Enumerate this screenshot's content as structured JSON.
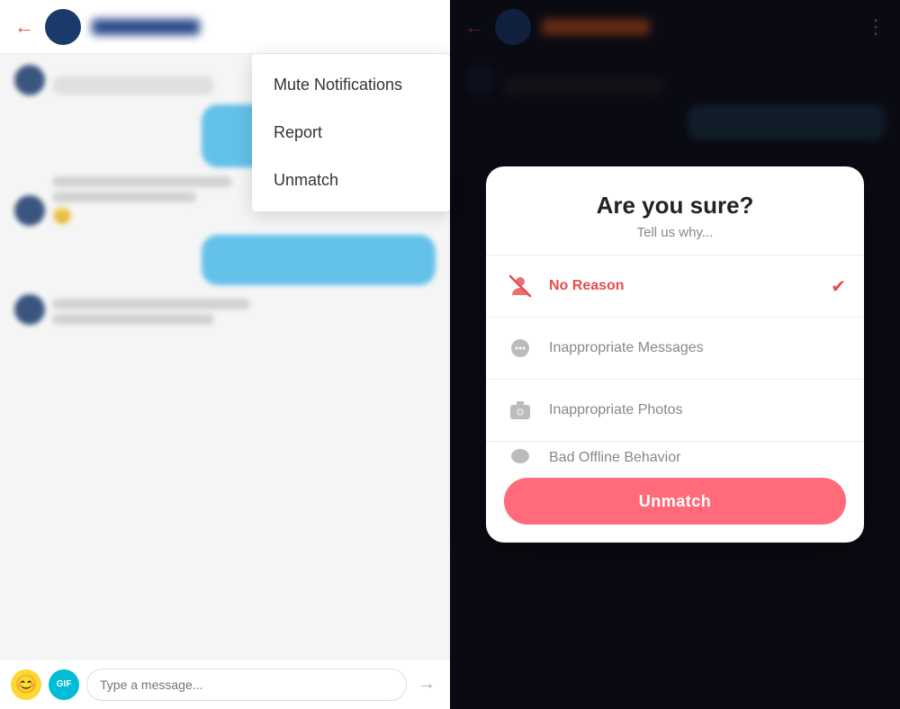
{
  "left": {
    "back_arrow": "←",
    "menu": {
      "items": [
        {
          "label": "Mute Notifications"
        },
        {
          "label": "Report"
        },
        {
          "label": "Unmatch"
        }
      ]
    },
    "footer": {
      "placeholder": "Type a message...",
      "gif_label": "GIF",
      "send_icon": "→",
      "emoji": "😊"
    }
  },
  "right": {
    "back_arrow": "←",
    "dots": "⋮",
    "modal": {
      "title": "Are you sure?",
      "subtitle": "Tell us why...",
      "options": [
        {
          "label": "No Reason",
          "selected": true,
          "icon": "no-reason"
        },
        {
          "label": "Inappropriate Messages",
          "selected": false,
          "icon": "message"
        },
        {
          "label": "Inappropriate Photos",
          "selected": false,
          "icon": "camera"
        },
        {
          "label": "Bad Offline Behavior",
          "selected": false,
          "icon": "offline"
        }
      ],
      "unmatch_label": "Unmatch"
    }
  }
}
